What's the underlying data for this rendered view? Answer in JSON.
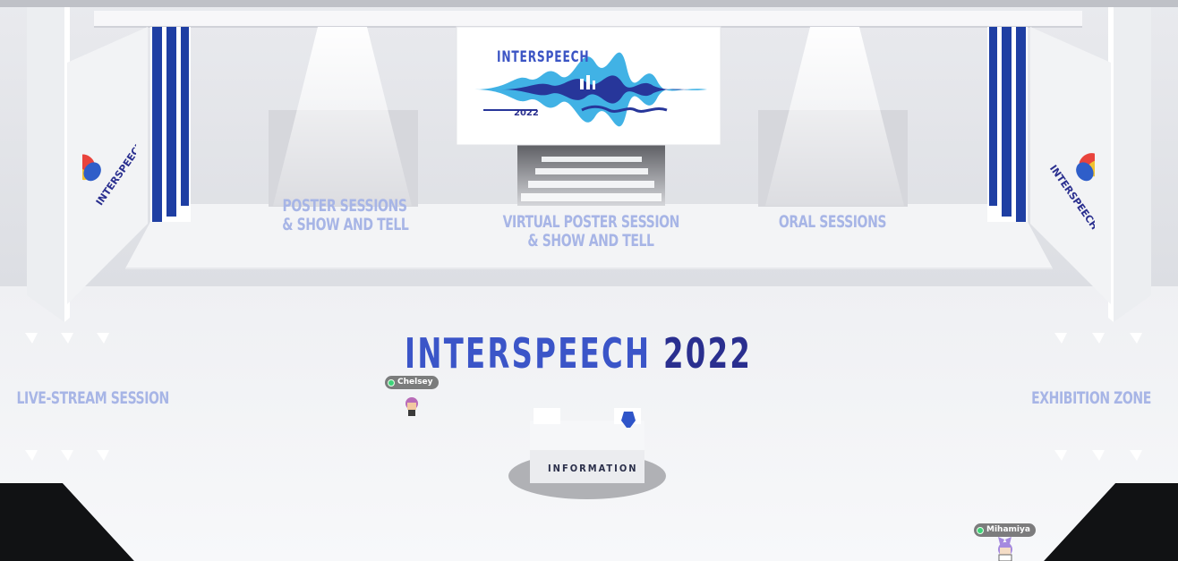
{
  "event": {
    "title_word": "INTERSPEECH",
    "title_year": "2022"
  },
  "banner": {
    "word": "INTERSPEECH",
    "year": "2022"
  },
  "zones": {
    "poster_line1": "POSTER SESSIONS",
    "poster_line2": "& SHOW AND TELL",
    "virtual_line1": "VIRTUAL POSTER SESSION",
    "virtual_line2": "& SHOW AND TELL",
    "oral": "ORAL SESSIONS",
    "livestream": "LIVE-STREAM SESSION",
    "exhibition": "EXHIBITION ZONE"
  },
  "info_desk": {
    "label": "INFORMATION"
  },
  "avatars": [
    {
      "name": "Chelsey",
      "status": "online"
    },
    {
      "name": "Mihamiya",
      "status": "online"
    }
  ],
  "colors": {
    "title_blue": "#3b55c8",
    "title_dark": "#2a2f8f",
    "zone_label": "#a7b5e6",
    "pillar_blue": "#1f3fa3",
    "online_dot": "#3ed37a"
  },
  "icons": {
    "left_logo": "interspeech-logo-icon",
    "right_logo": "interspeech-logo-icon",
    "vase": "vase-icon"
  }
}
